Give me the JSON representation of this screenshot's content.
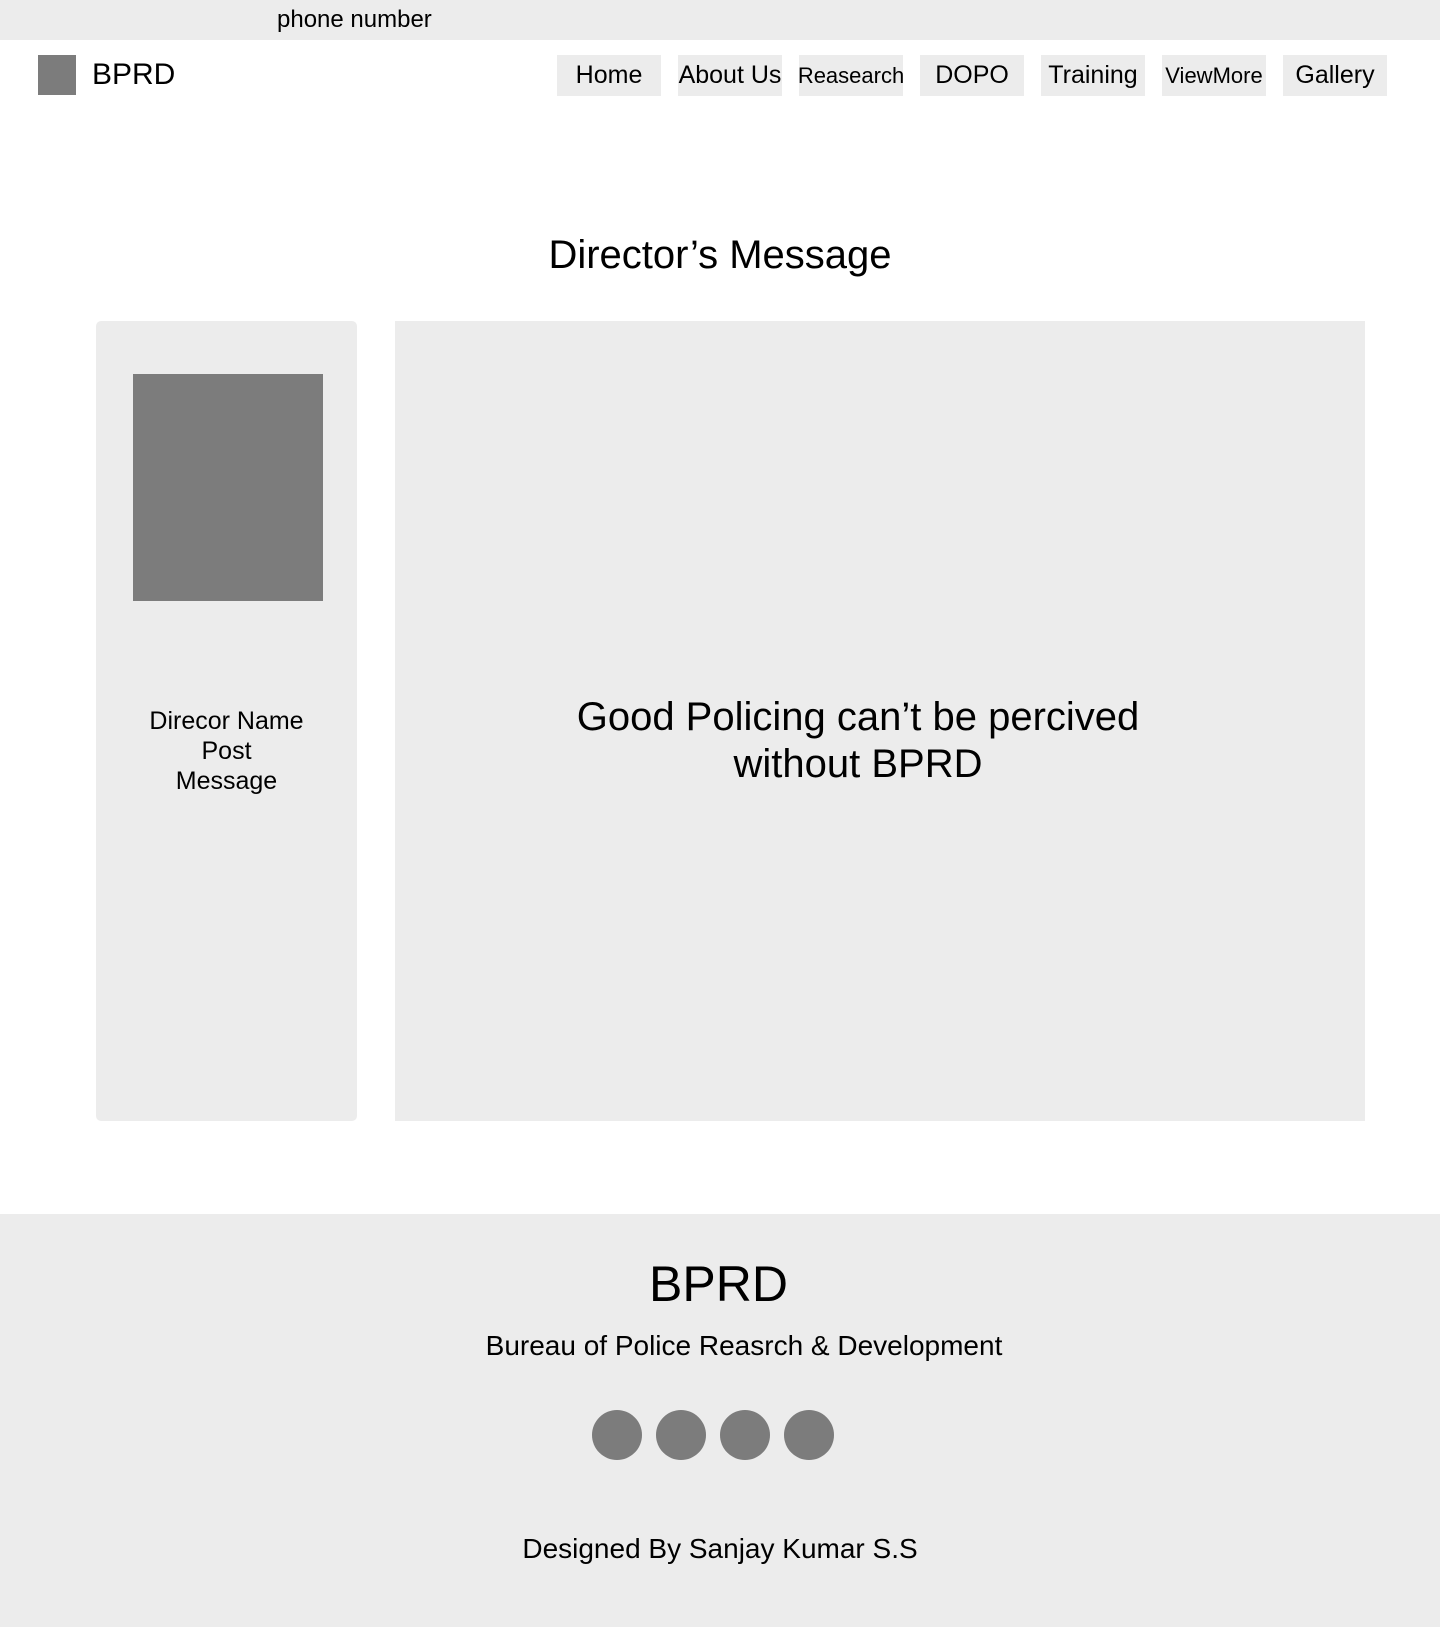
{
  "topbar": {
    "phone_label": "phone number"
  },
  "header": {
    "brand": "BPRD",
    "nav": [
      {
        "label": "Home"
      },
      {
        "label": "About Us"
      },
      {
        "label": "Reasearch"
      },
      {
        "label": "DOPO"
      },
      {
        "label": "Training"
      },
      {
        "label": "ViewMore"
      },
      {
        "label": "Gallery"
      }
    ]
  },
  "main": {
    "title": "Director’s Message",
    "profile": {
      "name": "Direcor Name",
      "post": "Post",
      "message": "Message"
    },
    "quote_line1": "Good Policing can’t be percived",
    "quote_line2": "without BPRD"
  },
  "footer": {
    "title": "BPRD",
    "subtitle": "Bureau of Police Reasrch & Development",
    "social_icons": [
      "social-icon-1",
      "social-icon-2",
      "social-icon-3",
      "social-icon-4"
    ],
    "credit": "Designed By Sanjay Kumar S.S"
  },
  "colors": {
    "panel_bg": "#ececec",
    "placeholder": "#7c7c7c",
    "text": "#000000"
  }
}
